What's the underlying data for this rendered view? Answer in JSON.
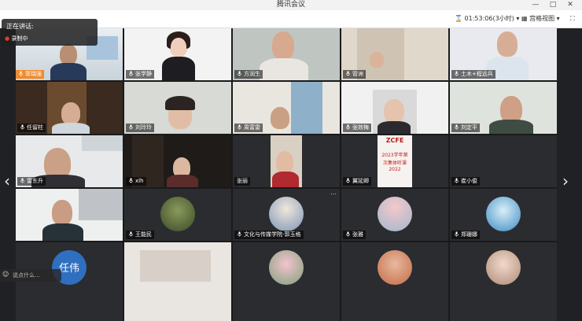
{
  "window": {
    "title": "腾讯会议",
    "controls": [
      "—",
      "□",
      "✕"
    ]
  },
  "toolbar": {
    "time": "01:53:06(3小时)",
    "view_label": "宫格视图",
    "fullscreen_icon": "fullscreen-icon"
  },
  "speaking": {
    "label": "正在讲话:",
    "recording": "录制中"
  },
  "tiles": [
    {
      "name": "郭瑞强"
    },
    {
      "name": "张学静"
    },
    {
      "name": "方润生"
    },
    {
      "name": "管洲"
    },
    {
      "name": "土木+程远兵"
    },
    {
      "name": "任留柱"
    },
    {
      "name": "刘玲玲"
    },
    {
      "name": "周富雷"
    },
    {
      "name": "张效梅"
    },
    {
      "name": "刘定平"
    },
    {
      "name": "雷东升"
    },
    {
      "name": "xlh"
    },
    {
      "name": "张丽"
    },
    {
      "name": "翼延卿"
    },
    {
      "name": "崔小俊"
    },
    {
      "name": " "
    },
    {
      "name": "王能民"
    },
    {
      "name": "文化与传媒学院-郭玉格"
    },
    {
      "name": "张雅"
    },
    {
      "name": "郑珊娜"
    },
    {
      "name": "任伟"
    },
    {
      "name": ""
    },
    {
      "name": ""
    },
    {
      "name": ""
    },
    {
      "name": ""
    }
  ],
  "zcfe": {
    "logo": "ZCFE",
    "year_text": "2023学年第",
    "sub_text": "次集体听课",
    "date": "2022"
  },
  "avatar_text": "任伟",
  "chat_hint": "说点什么...",
  "nav": {
    "left": "‹",
    "right": "›"
  }
}
